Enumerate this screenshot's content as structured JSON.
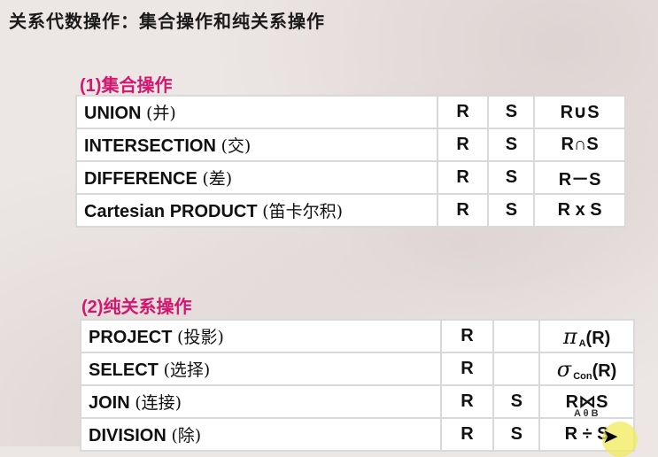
{
  "title": "关系代数操作：集合操作和纯关系操作",
  "section1": {
    "title": "(1)集合操作",
    "rows": [
      {
        "name": "UNION",
        "cn": "(并)",
        "a": "R",
        "b": "S",
        "result": "R∪S"
      },
      {
        "name": "INTERSECTION",
        "cn": "(交)",
        "a": "R",
        "b": "S",
        "result": "R∩S"
      },
      {
        "name": "DIFFERENCE",
        "cn": "(差)",
        "a": "R",
        "b": "S",
        "result": "R－S"
      },
      {
        "name": "Cartesian PRODUCT",
        "cn": "(笛卡尔积)",
        "a": "R",
        "b": "S",
        "result": "R x S"
      }
    ]
  },
  "section2": {
    "title": "(2)纯关系操作",
    "rows": [
      {
        "name": "PROJECT",
        "cn": "(投影)",
        "a": "R",
        "b": "",
        "op": "π",
        "sub": "A",
        "arg": "(R)"
      },
      {
        "name": "SELECT",
        "cn": "(选择)",
        "a": "R",
        "b": "",
        "op": "σ",
        "sub": "Con",
        "arg": "(R)"
      },
      {
        "name": "JOIN",
        "cn": "(连接)",
        "a": "R",
        "b": "S",
        "result": "R⋈S",
        "join_sub": "A θ B"
      },
      {
        "name": "DIVISION",
        "cn": "(除)",
        "a": "R",
        "b": "S",
        "result": "R ÷ S"
      }
    ]
  }
}
